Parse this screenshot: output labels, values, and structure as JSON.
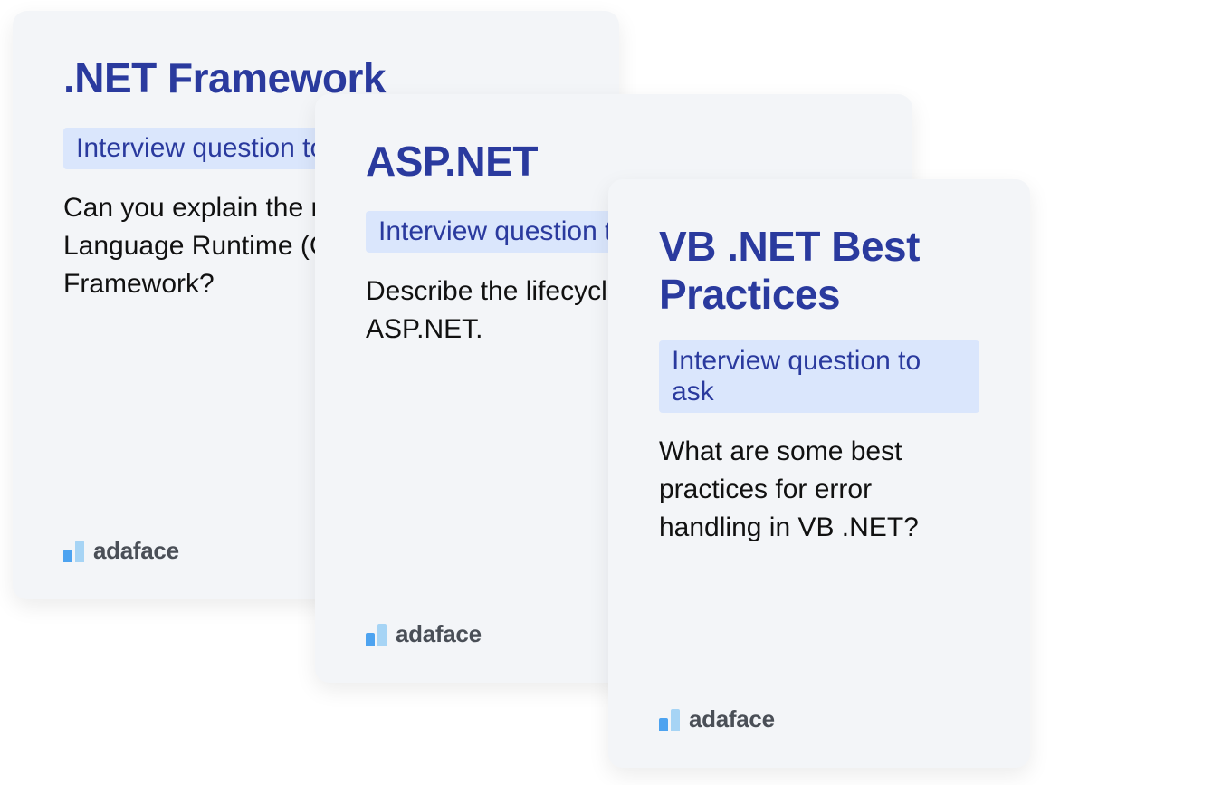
{
  "cards": [
    {
      "title": ".NET Framework",
      "tag": "Interview question to ask",
      "body": "Can you explain the role of the Common Language Runtime (CLR) in the .NET Framework?"
    },
    {
      "title": "ASP.NET",
      "tag": "Interview question to ask",
      "body": "Describe the lifecycle of a page in ASP.NET."
    },
    {
      "title": "VB .NET Best Practices",
      "tag": "Interview question to ask",
      "body": "What are some best practices for error handling in VB .NET?"
    }
  ],
  "brand": "adaface"
}
